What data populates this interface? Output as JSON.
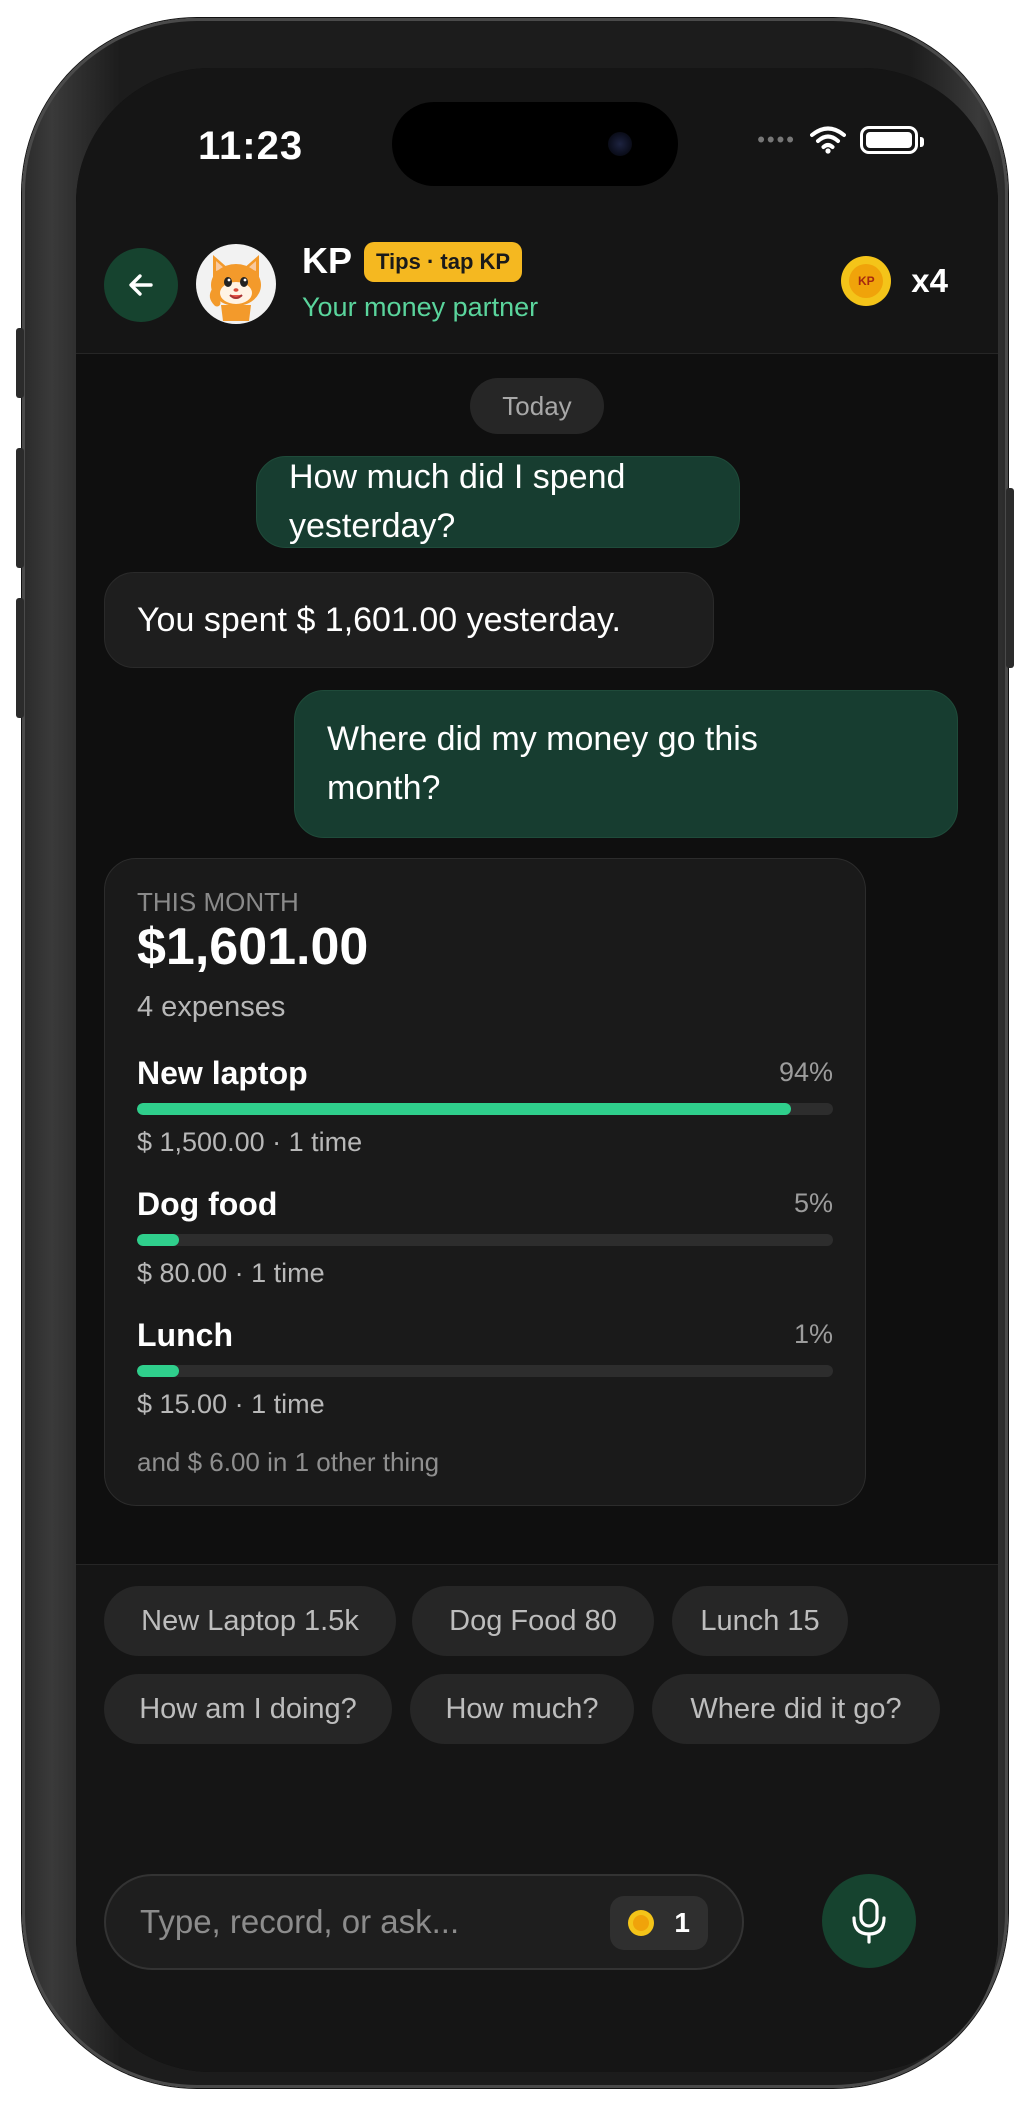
{
  "status_bar": {
    "time": "11:23",
    "signal_dots": "••••"
  },
  "header": {
    "back_icon": "arrow-left-icon",
    "avatar_icon": "cat-mascot-icon",
    "name": "KP",
    "tips_badge": "Tips · tap KP",
    "subtitle": "Your money partner",
    "coin_icon": "kp-coin-icon",
    "coin_count": "x4"
  },
  "chat": {
    "date_divider": "Today",
    "messages": [
      {
        "role": "user",
        "text": "How much did I spend yesterday?"
      },
      {
        "role": "bot",
        "text": "You spent $ 1,601.00 yesterday."
      },
      {
        "role": "user",
        "text": "Where did my money go this month?"
      }
    ],
    "summary_card": {
      "label": "THIS MONTH",
      "total": "$1,601.00",
      "count": "4 expenses",
      "items": [
        {
          "name": "New laptop",
          "percent_label": "94%",
          "percent": 94,
          "detail": "$ 1,500.00 · 1 time"
        },
        {
          "name": "Dog food",
          "percent_label": "5%",
          "percent": 5,
          "detail": "$ 80.00 · 1 time"
        },
        {
          "name": "Lunch",
          "percent_label": "1%",
          "percent": 1,
          "detail": "$ 15.00 · 1 time"
        }
      ],
      "footer": "and $ 6.00 in 1 other thing"
    }
  },
  "suggestions": {
    "row1": [
      "New Laptop 1.5k",
      "Dog Food 80",
      "Lunch 15"
    ],
    "row2": [
      "How am I doing?",
      "How much?",
      "Where did it go?"
    ]
  },
  "composer": {
    "placeholder": "Type, record, or ask...",
    "credit_count": "1",
    "mic_icon": "microphone-icon"
  },
  "colors": {
    "background": "#0f0f0f",
    "accent_green": "#2fcf8c",
    "user_bubble": "#173d30",
    "badge_yellow": "#f5b820",
    "subtitle_green": "#5ad49c"
  }
}
